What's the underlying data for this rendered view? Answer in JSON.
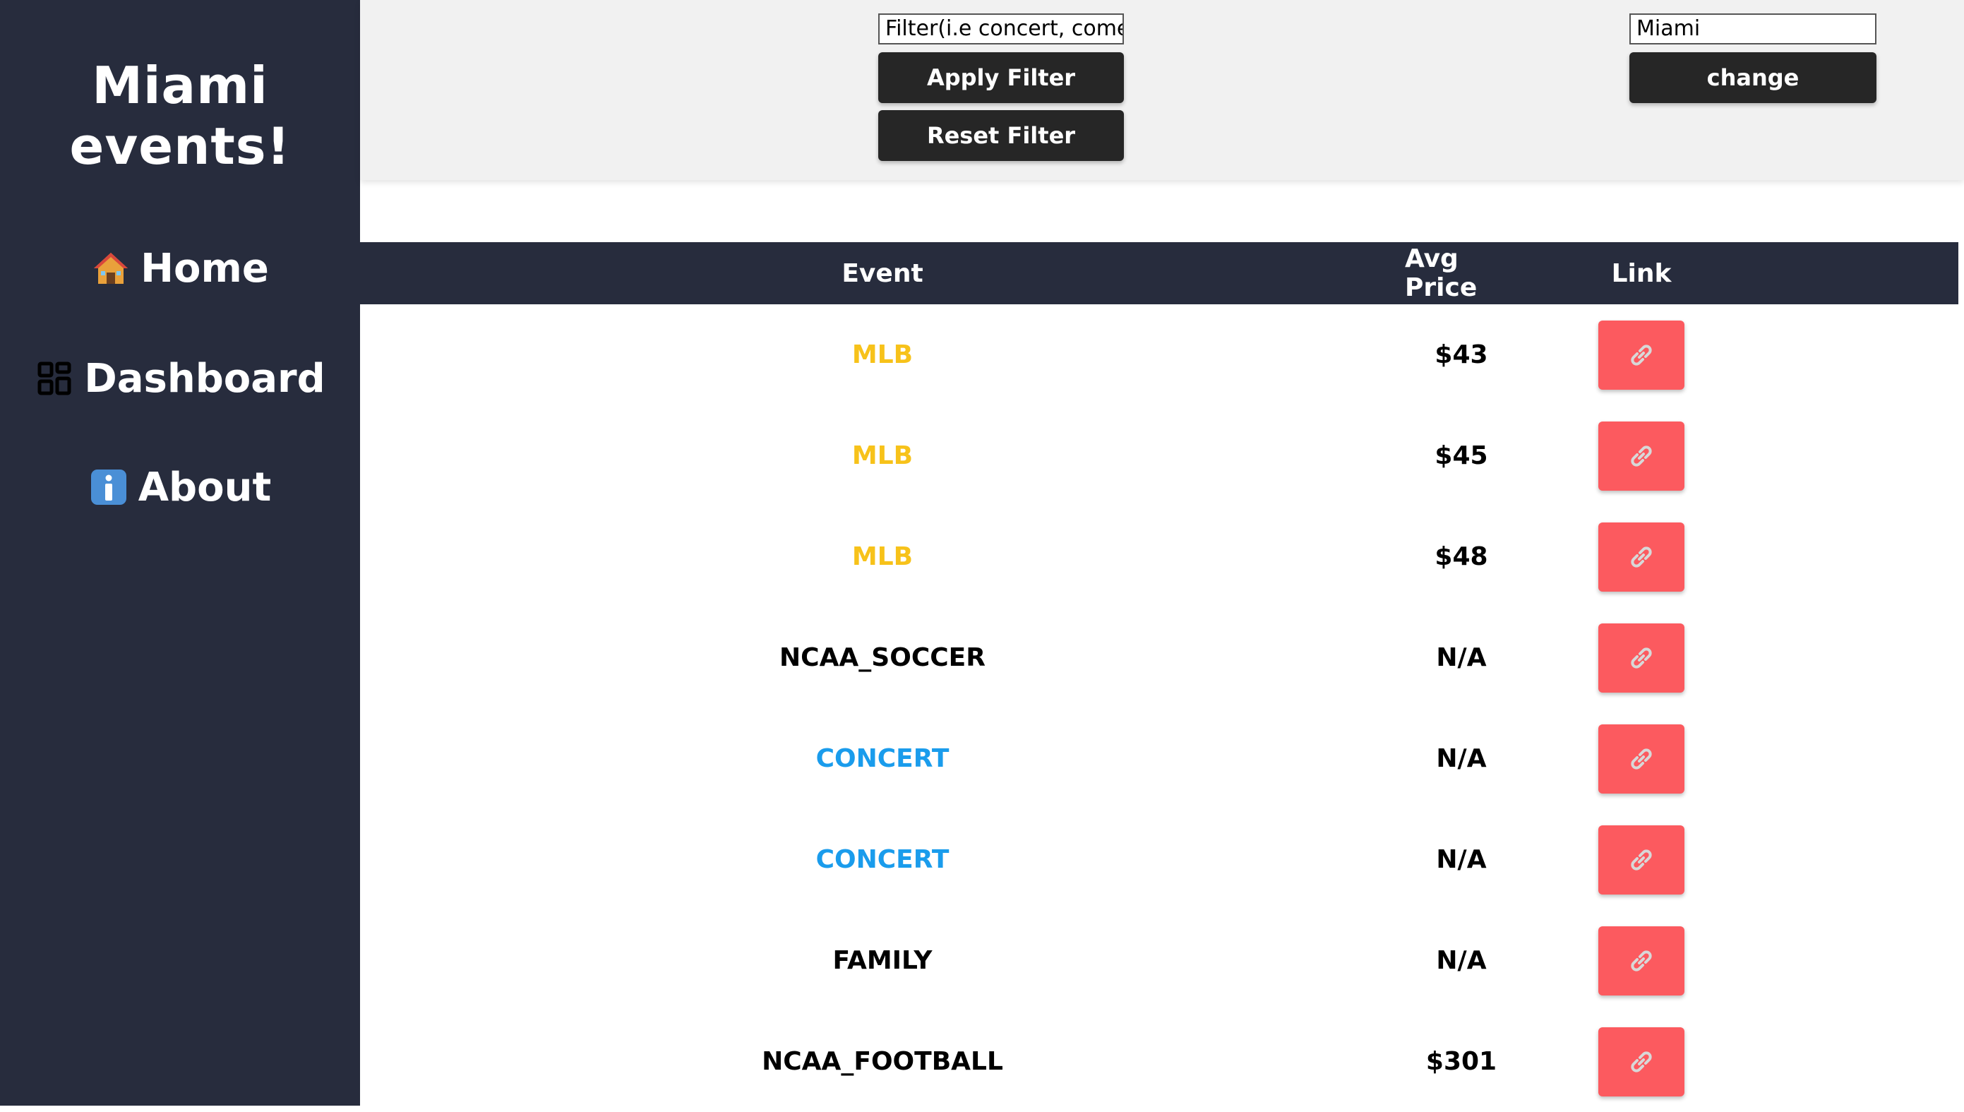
{
  "sidebar": {
    "title_line1": "Miami",
    "title_line2": "events!",
    "items": [
      {
        "label": "Home",
        "icon": "house-icon"
      },
      {
        "label": "Dashboard",
        "icon": "grid-icon"
      },
      {
        "label": "About",
        "icon": "info-icon"
      }
    ]
  },
  "toolbar": {
    "filter_placeholder": "Filter(i.e concert, comedy)",
    "apply_label": "Apply Filter",
    "reset_label": "Reset Filter",
    "city_value": "Miami",
    "change_label": "change"
  },
  "table": {
    "headers": [
      "Event",
      "Avg Price",
      "Link"
    ],
    "rows": [
      {
        "event": "MLB",
        "price": "$43",
        "color": "#f7c21a"
      },
      {
        "event": "MLB",
        "price": "$45",
        "color": "#f7c21a"
      },
      {
        "event": "MLB",
        "price": "$48",
        "color": "#f7c21a"
      },
      {
        "event": "NCAA_SOCCER",
        "price": "N/A",
        "color": "#000000"
      },
      {
        "event": "CONCERT",
        "price": "N/A",
        "color": "#1a9cec"
      },
      {
        "event": "CONCERT",
        "price": "N/A",
        "color": "#1a9cec"
      },
      {
        "event": "FAMILY",
        "price": "N/A",
        "color": "#000000"
      },
      {
        "event": "NCAA_FOOTBALL",
        "price": "$301",
        "color": "#000000"
      }
    ],
    "link_icon": "link-icon",
    "link_button_color": "#fc5a5f"
  },
  "colors": {
    "sidebar_bg": "#272c3d",
    "button_bg": "#262626",
    "mlb": "#f7c21a",
    "concert": "#1a9cec"
  }
}
